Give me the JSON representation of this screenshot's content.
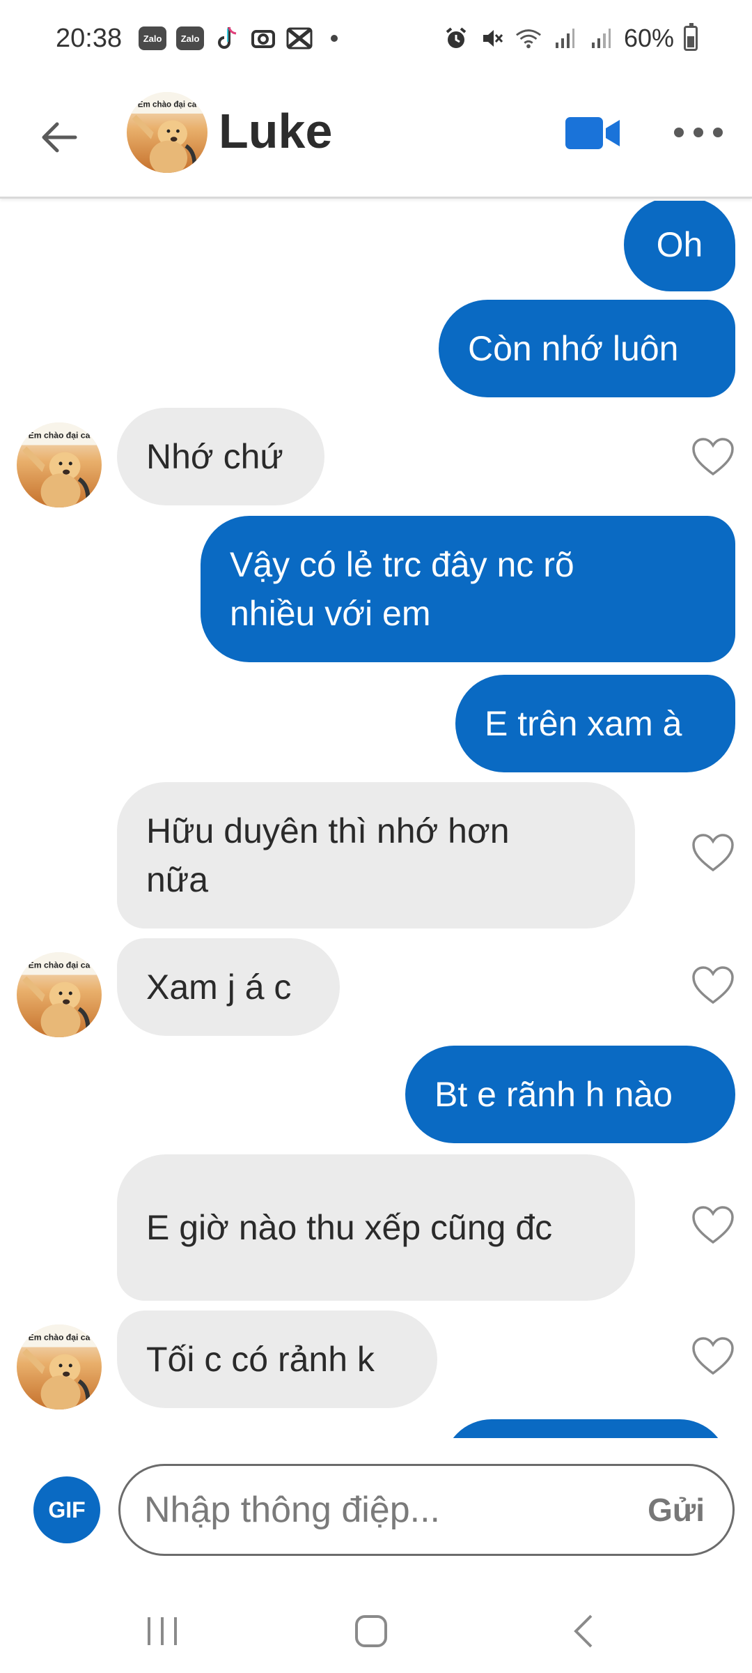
{
  "status_bar": {
    "time": "20:38",
    "app_icons": [
      "zalo-icon",
      "zalo-icon",
      "tiktok-icon",
      "capcut-icon",
      "capcut-x-icon"
    ],
    "zalo_label": "Zalo",
    "battery": "60%"
  },
  "header": {
    "contact_name": "Luke",
    "avatar_caption": "Em chào đại ca"
  },
  "messages": [
    {
      "from": "me",
      "text": "Oh"
    },
    {
      "from": "me",
      "text": "Còn nhớ luôn"
    },
    {
      "from": "them",
      "text": "Nhớ chứ"
    },
    {
      "from": "me",
      "text": "Vậy có lẻ trc đây nc rõ nhiều với em"
    },
    {
      "from": "me",
      "text": "E trên xam à"
    },
    {
      "from": "them",
      "text": "Hữu duyên thì nhớ hơn nữa"
    },
    {
      "from": "them",
      "text": "Xam j á c"
    },
    {
      "from": "me",
      "text": "Bt e rãnh h nào"
    },
    {
      "from": "them",
      "text": "E giờ nào thu xếp cũng đc"
    },
    {
      "from": "them",
      "text": "Tối c có rảnh k"
    }
  ],
  "input": {
    "gif_label": "GIF",
    "placeholder": "Nhập thông điệp...",
    "send_label": "Gửi"
  },
  "colors": {
    "outgoing_bubble": "#0a6ac3",
    "incoming_bubble": "#ebebeb",
    "accent": "#0a6ac3"
  }
}
